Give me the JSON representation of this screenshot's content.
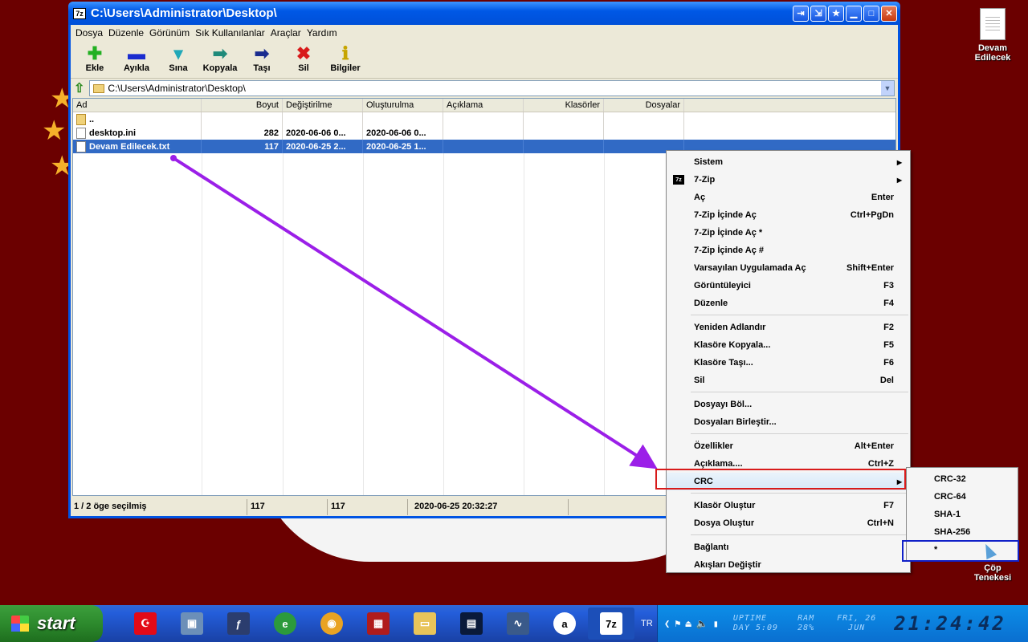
{
  "window": {
    "title": "C:\\Users\\Administrator\\Desktop\\",
    "app_badge": "7z"
  },
  "menubar": [
    "Dosya",
    "Düzenle",
    "Görünüm",
    "Sık Kullanılanlar",
    "Araçlar",
    "Yardım"
  ],
  "toolbar": [
    {
      "label": "Ekle",
      "icon": "plus-icon"
    },
    {
      "label": "Ayıkla",
      "icon": "minus-icon"
    },
    {
      "label": "Sına",
      "icon": "check-icon"
    },
    {
      "label": "Kopyala",
      "icon": "copy-arrow-icon"
    },
    {
      "label": "Taşı",
      "icon": "move-arrow-icon"
    },
    {
      "label": "Sil",
      "icon": "x-icon"
    },
    {
      "label": "Bilgiler",
      "icon": "info-icon"
    }
  ],
  "address": "C:\\Users\\Administrator\\Desktop\\",
  "columns": [
    "Ad",
    "Boyut",
    "Değiştirilme",
    "Oluşturulma",
    "Açıklama",
    "Klasörler",
    "Dosyalar"
  ],
  "rows": [
    {
      "name": "..",
      "size": "",
      "modified": "",
      "created": ""
    },
    {
      "name": "desktop.ini",
      "size": "282",
      "modified": "2020-06-06 0...",
      "created": "2020-06-06 0..."
    },
    {
      "name": "Devam Edilecek.txt",
      "size": "117",
      "modified": "2020-06-25 2...",
      "created": "2020-06-25 1..."
    }
  ],
  "status": {
    "selection": "1 / 2 öge seçilmiş",
    "size1": "117",
    "size2": "117",
    "date": "2020-06-25 20:32:27"
  },
  "context_menu": {
    "groups": [
      [
        {
          "label": "Sistem",
          "shortcut": "",
          "submenu": true
        },
        {
          "label": "7-Zip",
          "shortcut": "",
          "submenu": true,
          "icon": "7z"
        },
        {
          "label": "Aç",
          "shortcut": "Enter"
        },
        {
          "label": "7-Zip İçinde Aç",
          "shortcut": "Ctrl+PgDn"
        },
        {
          "label": "7-Zip İçinde Aç *",
          "shortcut": ""
        },
        {
          "label": "7-Zip İçinde Aç #",
          "shortcut": ""
        },
        {
          "label": "Varsayılan Uygulamada Aç",
          "shortcut": "Shift+Enter"
        },
        {
          "label": "Görüntüleyici",
          "shortcut": "F3"
        },
        {
          "label": "Düzenle",
          "shortcut": "F4"
        }
      ],
      [
        {
          "label": "Yeniden Adlandır",
          "shortcut": "F2"
        },
        {
          "label": "Klasöre Kopyala...",
          "shortcut": "F5"
        },
        {
          "label": "Klasöre Taşı...",
          "shortcut": "F6"
        },
        {
          "label": "Sil",
          "shortcut": "Del"
        }
      ],
      [
        {
          "label": "Dosyayı Böl...",
          "shortcut": ""
        },
        {
          "label": "Dosyaları Birleştir...",
          "shortcut": ""
        }
      ],
      [
        {
          "label": "Özellikler",
          "shortcut": "Alt+Enter"
        },
        {
          "label": "Açıklama....",
          "shortcut": "Ctrl+Z"
        },
        {
          "label": "CRC",
          "shortcut": "",
          "submenu": true,
          "highlight": true
        }
      ],
      [
        {
          "label": "Klasör Oluştur",
          "shortcut": "F7"
        },
        {
          "label": "Dosya Oluştur",
          "shortcut": "Ctrl+N"
        }
      ],
      [
        {
          "label": "Bağlantı",
          "shortcut": ""
        },
        {
          "label": "Akışları Değiştir",
          "shortcut": ""
        }
      ]
    ]
  },
  "crc_submenu": [
    "CRC-32",
    "CRC-64",
    "SHA-1",
    "SHA-256",
    "*"
  ],
  "desktop_icons": [
    {
      "label_line1": "Devam",
      "label_line2": "Edilecek"
    },
    {
      "label_line1": "Çöp",
      "label_line2": "Tenekesi"
    }
  ],
  "taskbar": {
    "start_label": "start",
    "lang": "TR",
    "uptime_label": "UPTIME",
    "uptime_value": "DAY 5:09",
    "ram_label": "RAM",
    "ram_value": "28%",
    "date_line1": "FRI, 26",
    "date_line2": "JUN",
    "clock": "21:24:42"
  },
  "colors": {
    "desktop": "#6b0000",
    "selection": "#316ac5",
    "arrow": "#9b1fe8",
    "red_box": "#d81b1b",
    "blue_box": "#1020c8"
  }
}
